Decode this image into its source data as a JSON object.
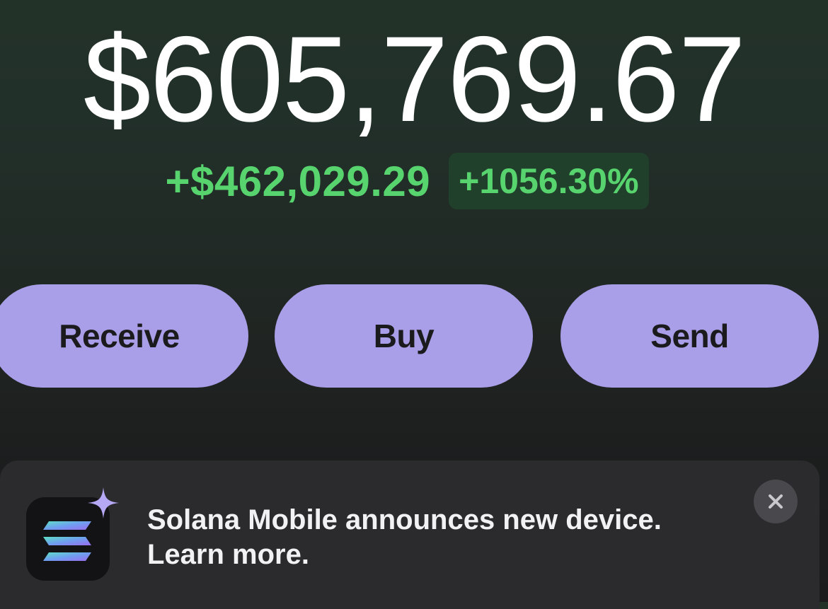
{
  "balance": {
    "total": "$605,769.67",
    "change_amount": "+$462,029.29",
    "change_percent": "+1056.30%"
  },
  "actions": {
    "receive_label": "Receive",
    "buy_label": "Buy",
    "send_label": "Send"
  },
  "banner": {
    "line1": "Solana Mobile announces new device.",
    "line2": "Learn more.",
    "app_icon": "solana-logo-icon",
    "badge_icon": "sparkle-icon",
    "close_icon": "close-icon"
  },
  "colors": {
    "positive": "#58d46f",
    "positive_bg": "#21402b",
    "accent_button": "#a99ee8",
    "banner_bg": "#2b2b2e"
  }
}
